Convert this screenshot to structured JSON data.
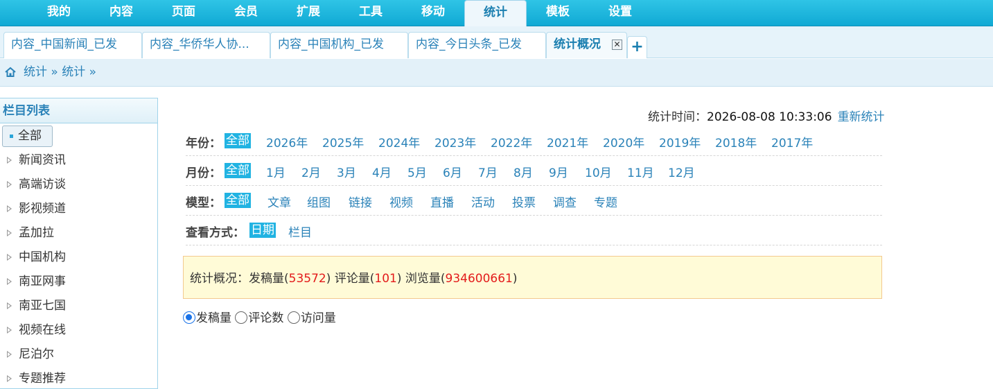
{
  "top_nav": {
    "items": [
      "我的",
      "内容",
      "页面",
      "会员",
      "扩展",
      "工具",
      "移动",
      "统计",
      "模板",
      "设置"
    ],
    "active_index": 7
  },
  "tabs": {
    "items": [
      "内容_中国新闻_已发",
      "内容_华侨华人协...",
      "内容_中国机构_已发",
      "内容_今日头条_已发",
      "统计概况"
    ],
    "active_index": 4,
    "close_glyph": "✕",
    "add_glyph": "+"
  },
  "breadcrumb": {
    "text": "统计 » 统计 »",
    "icon": "home-icon"
  },
  "sidebar": {
    "title": "栏目列表",
    "all_label": "全部",
    "items": [
      "新闻资讯",
      "高端访谈",
      "影视频道",
      "孟加拉",
      "中国机构",
      "南亚网事",
      "南亚七国",
      "视频在线",
      "尼泊尔",
      "专题推荐"
    ]
  },
  "stat_time": {
    "label": "统计时间：",
    "value": "2026-08-08 10:33:06",
    "refresh": "重新统计"
  },
  "filters": {
    "year": {
      "label": "年份：",
      "options": [
        "全部",
        "2026年",
        "2025年",
        "2024年",
        "2023年",
        "2022年",
        "2021年",
        "2020年",
        "2019年",
        "2018年",
        "2017年"
      ]
    },
    "month": {
      "label": "月份：",
      "options": [
        "全部",
        "1月",
        "2月",
        "3月",
        "4月",
        "5月",
        "6月",
        "7月",
        "8月",
        "9月",
        "10月",
        "11月",
        "12月"
      ]
    },
    "model": {
      "label": "模型：",
      "options": [
        "全部",
        "文章",
        "组图",
        "链接",
        "视频",
        "直播",
        "活动",
        "投票",
        "调查",
        "专题"
      ]
    },
    "view": {
      "label": "查看方式：",
      "options": [
        "日期",
        "栏目"
      ]
    }
  },
  "summary": {
    "label": "统计概况：",
    "posts_label": "发稿量(",
    "posts": "53572",
    "comments_label": ")  评论量(",
    "comments": "101",
    "views_label": ")  浏览量(",
    "views": "934600661",
    "end": ")"
  },
  "radios": {
    "options": [
      "发稿量",
      "评论数",
      "访问量"
    ],
    "checked_index": 0
  },
  "colors": {
    "nav_bg": "#10a9d4",
    "link": "#2a82b8",
    "selected_bg": "#21b3e2",
    "summary_bg": "#fffbd7",
    "number_red": "#e31b1b"
  }
}
